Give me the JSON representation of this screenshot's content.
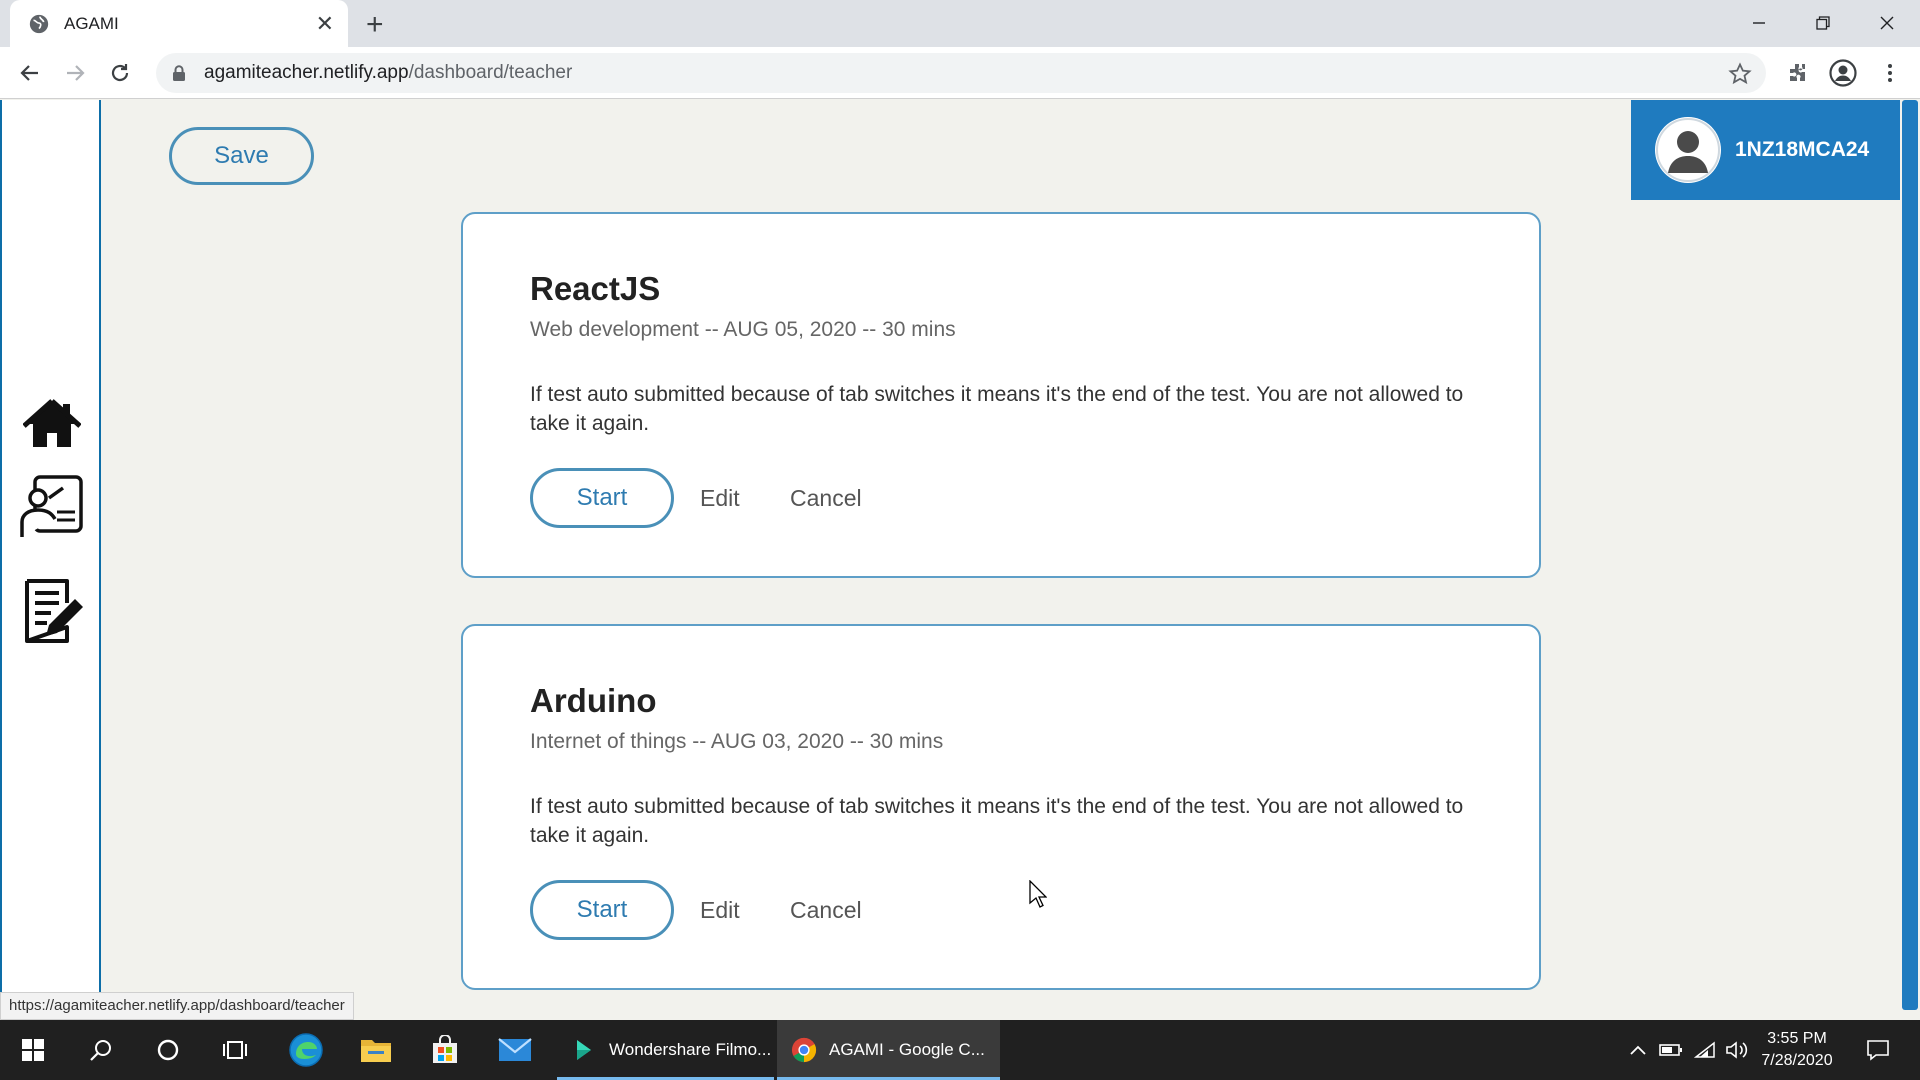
{
  "browser": {
    "tab_title": "AGAMI",
    "url_host": "agamiteacher.netlify.app",
    "url_path": "/dashboard/teacher"
  },
  "page": {
    "save_label": "Save",
    "profile_id": "1NZ18MCA24",
    "status_url": "https://agamiteacher.netlify.app/dashboard/teacher"
  },
  "sidebar": {
    "icons": [
      "home-icon",
      "teacher-board-icon",
      "edit-notes-icon"
    ]
  },
  "tests": [
    {
      "title": "ReactJS",
      "meta": "Web development -- AUG 05, 2020 -- 30 mins",
      "description": "If test auto submitted because of tab switches it means it's the end of the test. You are not allowed to take it again.",
      "start_label": "Start",
      "edit_label": "Edit",
      "cancel_label": "Cancel"
    },
    {
      "title": "Arduino",
      "meta": "Internet of things -- AUG 03, 2020 -- 30 mins",
      "description": "If test auto submitted because of tab switches it means it's the end of the test. You are not allowed to take it again.",
      "start_label": "Start",
      "edit_label": "Edit",
      "cancel_label": "Cancel"
    }
  ],
  "taskbar": {
    "apps": [
      {
        "label": "Wondershare Filmo...",
        "icon": "filmora-icon"
      },
      {
        "label": "AGAMI - Google C...",
        "icon": "chrome-icon"
      }
    ],
    "time": "3:55 PM",
    "date": "7/28/2020"
  },
  "colors": {
    "accent": "#1f7bbf",
    "button_border": "#4a90b8",
    "page_bg": "#f2f2ed"
  }
}
